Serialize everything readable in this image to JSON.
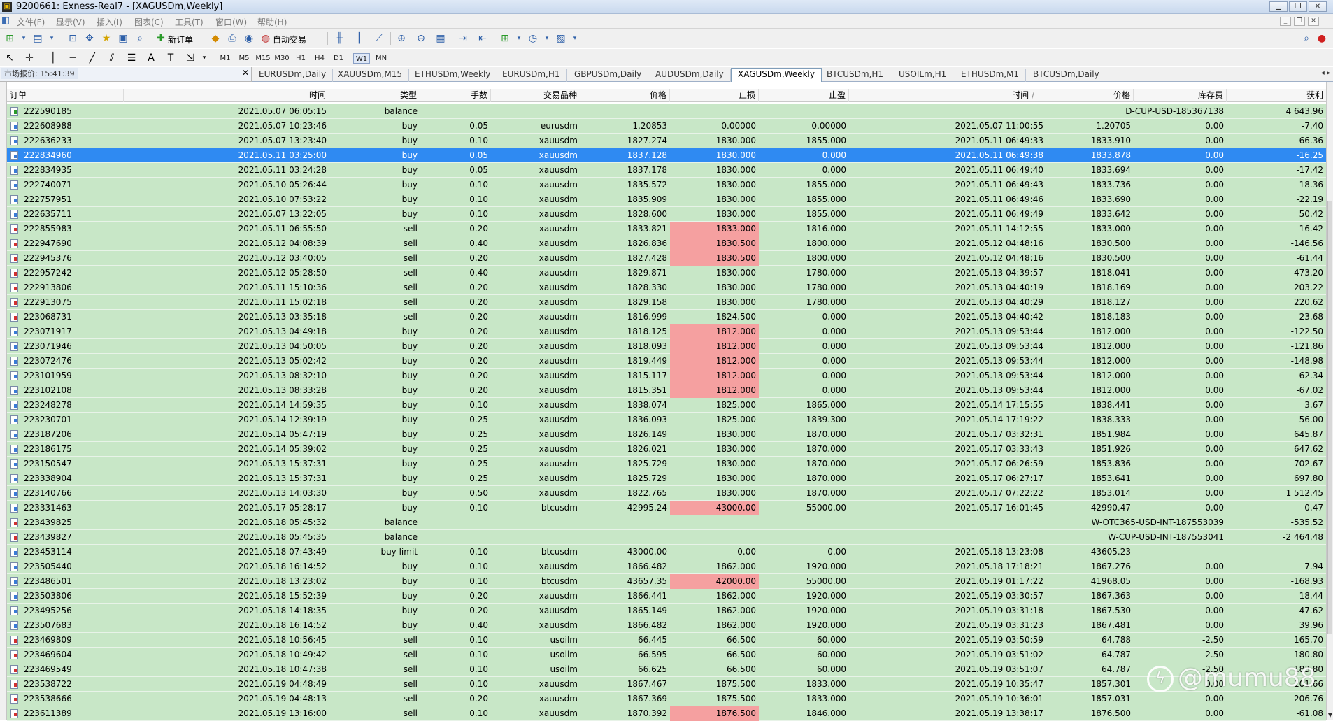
{
  "window": {
    "title": "9200661: Exness-Real7 - [XAGUSDm,Weekly]",
    "app_icon": "mt4-icon",
    "controls": [
      "minimize",
      "restore",
      "close"
    ]
  },
  "menu": [
    "文件(F)",
    "显示(V)",
    "插入(I)",
    "图表(C)",
    "工具(T)",
    "窗口(W)",
    "帮助(H)"
  ],
  "toolbar": {
    "new_order_label": "新订单",
    "auto_trading_label": "自动交易",
    "timeframes": [
      "M1",
      "M5",
      "M15",
      "M30",
      "H1",
      "H4",
      "D1",
      "W1",
      "MN"
    ],
    "active_timeframe": "W1"
  },
  "market_watch": {
    "label": "市场报价: 15:41:39"
  },
  "chart_tabs": [
    "EURUSDm,Daily",
    "XAUUSDm,M15",
    "ETHUSDm,Weekly",
    "EURUSDm,H1",
    "GBPUSDm,Daily",
    "AUDUSDm,Daily",
    "XAGUSDm,Weekly",
    "BTCUSDm,H1",
    "USOILm,H1",
    "ETHUSDm,M1",
    "BTCUSDm,Daily"
  ],
  "active_tab": "XAGUSDm,Weekly",
  "columns": [
    "订单",
    "时间",
    "类型",
    "手数",
    "交易品种",
    "价格",
    "止损",
    "止盈",
    "时间",
    "价格",
    "库存费",
    "获利"
  ],
  "sort_indicator": "/",
  "colors": {
    "row_bg": "#c8e7c7",
    "selected_bg": "#2f8af2",
    "sl_hit_bg": "#f5a0a0"
  },
  "rows": [
    {
      "order": "222590185",
      "open_time": "2021.05.07 06:05:15",
      "type": "balance",
      "lots": "",
      "symbol": "",
      "open_price": "",
      "sl": "",
      "tp": "",
      "close_time": "",
      "close_price": "D-CUP-USD-185367138",
      "swap": "",
      "profit": "4 643.96",
      "sl_hit": false,
      "icon": "balance-plus"
    },
    {
      "order": "222608988",
      "open_time": "2021.05.07 10:23:46",
      "type": "buy",
      "lots": "0.05",
      "symbol": "eurusdm",
      "open_price": "1.20853",
      "sl": "0.00000",
      "tp": "0.00000",
      "close_time": "2021.05.07 11:00:55",
      "close_price": "1.20705",
      "swap": "0.00",
      "profit": "-7.40",
      "sl_hit": false,
      "icon": "buy"
    },
    {
      "order": "222636233",
      "open_time": "2021.05.07 13:23:40",
      "type": "buy",
      "lots": "0.10",
      "symbol": "xauusdm",
      "open_price": "1827.274",
      "sl": "1830.000",
      "tp": "1855.000",
      "close_time": "2021.05.11 06:49:33",
      "close_price": "1833.910",
      "swap": "0.00",
      "profit": "66.36",
      "sl_hit": false,
      "icon": "buy"
    },
    {
      "order": "222834960",
      "open_time": "2021.05.11 03:25:00",
      "type": "buy",
      "lots": "0.05",
      "symbol": "xauusdm",
      "open_price": "1837.128",
      "sl": "1830.000",
      "tp": "0.000",
      "close_time": "2021.05.11 06:49:38",
      "close_price": "1833.878",
      "swap": "0.00",
      "profit": "-16.25",
      "sl_hit": false,
      "icon": "buy",
      "selected": true
    },
    {
      "order": "222834935",
      "open_time": "2021.05.11 03:24:28",
      "type": "buy",
      "lots": "0.05",
      "symbol": "xauusdm",
      "open_price": "1837.178",
      "sl": "1830.000",
      "tp": "0.000",
      "close_time": "2021.05.11 06:49:40",
      "close_price": "1833.694",
      "swap": "0.00",
      "profit": "-17.42",
      "sl_hit": false,
      "icon": "buy"
    },
    {
      "order": "222740071",
      "open_time": "2021.05.10 05:26:44",
      "type": "buy",
      "lots": "0.10",
      "symbol": "xauusdm",
      "open_price": "1835.572",
      "sl": "1830.000",
      "tp": "1855.000",
      "close_time": "2021.05.11 06:49:43",
      "close_price": "1833.736",
      "swap": "0.00",
      "profit": "-18.36",
      "sl_hit": false,
      "icon": "buy"
    },
    {
      "order": "222757951",
      "open_time": "2021.05.10 07:53:22",
      "type": "buy",
      "lots": "0.10",
      "symbol": "xauusdm",
      "open_price": "1835.909",
      "sl": "1830.000",
      "tp": "1855.000",
      "close_time": "2021.05.11 06:49:46",
      "close_price": "1833.690",
      "swap": "0.00",
      "profit": "-22.19",
      "sl_hit": false,
      "icon": "buy"
    },
    {
      "order": "222635711",
      "open_time": "2021.05.07 13:22:05",
      "type": "buy",
      "lots": "0.10",
      "symbol": "xauusdm",
      "open_price": "1828.600",
      "sl": "1830.000",
      "tp": "1855.000",
      "close_time": "2021.05.11 06:49:49",
      "close_price": "1833.642",
      "swap": "0.00",
      "profit": "50.42",
      "sl_hit": false,
      "icon": "buy"
    },
    {
      "order": "222855983",
      "open_time": "2021.05.11 06:55:50",
      "type": "sell",
      "lots": "0.20",
      "symbol": "xauusdm",
      "open_price": "1833.821",
      "sl": "1833.000",
      "tp": "1816.000",
      "close_time": "2021.05.11 14:12:55",
      "close_price": "1833.000",
      "swap": "0.00",
      "profit": "16.42",
      "sl_hit": true,
      "icon": "sell"
    },
    {
      "order": "222947690",
      "open_time": "2021.05.12 04:08:39",
      "type": "sell",
      "lots": "0.40",
      "symbol": "xauusdm",
      "open_price": "1826.836",
      "sl": "1830.500",
      "tp": "1800.000",
      "close_time": "2021.05.12 04:48:16",
      "close_price": "1830.500",
      "swap": "0.00",
      "profit": "-146.56",
      "sl_hit": true,
      "icon": "sell"
    },
    {
      "order": "222945376",
      "open_time": "2021.05.12 03:40:05",
      "type": "sell",
      "lots": "0.20",
      "symbol": "xauusdm",
      "open_price": "1827.428",
      "sl": "1830.500",
      "tp": "1800.000",
      "close_time": "2021.05.12 04:48:16",
      "close_price": "1830.500",
      "swap": "0.00",
      "profit": "-61.44",
      "sl_hit": true,
      "icon": "sell"
    },
    {
      "order": "222957242",
      "open_time": "2021.05.12 05:28:50",
      "type": "sell",
      "lots": "0.40",
      "symbol": "xauusdm",
      "open_price": "1829.871",
      "sl": "1830.000",
      "tp": "1780.000",
      "close_time": "2021.05.13 04:39:57",
      "close_price": "1818.041",
      "swap": "0.00",
      "profit": "473.20",
      "sl_hit": false,
      "icon": "sell"
    },
    {
      "order": "222913806",
      "open_time": "2021.05.11 15:10:36",
      "type": "sell",
      "lots": "0.20",
      "symbol": "xauusdm",
      "open_price": "1828.330",
      "sl": "1830.000",
      "tp": "1780.000",
      "close_time": "2021.05.13 04:40:19",
      "close_price": "1818.169",
      "swap": "0.00",
      "profit": "203.22",
      "sl_hit": false,
      "icon": "sell"
    },
    {
      "order": "222913075",
      "open_time": "2021.05.11 15:02:18",
      "type": "sell",
      "lots": "0.20",
      "symbol": "xauusdm",
      "open_price": "1829.158",
      "sl": "1830.000",
      "tp": "1780.000",
      "close_time": "2021.05.13 04:40:29",
      "close_price": "1818.127",
      "swap": "0.00",
      "profit": "220.62",
      "sl_hit": false,
      "icon": "sell"
    },
    {
      "order": "223068731",
      "open_time": "2021.05.13 03:35:18",
      "type": "sell",
      "lots": "0.20",
      "symbol": "xauusdm",
      "open_price": "1816.999",
      "sl": "1824.500",
      "tp": "0.000",
      "close_time": "2021.05.13 04:40:42",
      "close_price": "1818.183",
      "swap": "0.00",
      "profit": "-23.68",
      "sl_hit": false,
      "icon": "sell"
    },
    {
      "order": "223071917",
      "open_time": "2021.05.13 04:49:18",
      "type": "buy",
      "lots": "0.20",
      "symbol": "xauusdm",
      "open_price": "1818.125",
      "sl": "1812.000",
      "tp": "0.000",
      "close_time": "2021.05.13 09:53:44",
      "close_price": "1812.000",
      "swap": "0.00",
      "profit": "-122.50",
      "sl_hit": true,
      "icon": "buy"
    },
    {
      "order": "223071946",
      "open_time": "2021.05.13 04:50:05",
      "type": "buy",
      "lots": "0.20",
      "symbol": "xauusdm",
      "open_price": "1818.093",
      "sl": "1812.000",
      "tp": "0.000",
      "close_time": "2021.05.13 09:53:44",
      "close_price": "1812.000",
      "swap": "0.00",
      "profit": "-121.86",
      "sl_hit": true,
      "icon": "buy"
    },
    {
      "order": "223072476",
      "open_time": "2021.05.13 05:02:42",
      "type": "buy",
      "lots": "0.20",
      "symbol": "xauusdm",
      "open_price": "1819.449",
      "sl": "1812.000",
      "tp": "0.000",
      "close_time": "2021.05.13 09:53:44",
      "close_price": "1812.000",
      "swap": "0.00",
      "profit": "-148.98",
      "sl_hit": true,
      "icon": "buy"
    },
    {
      "order": "223101959",
      "open_time": "2021.05.13 08:32:10",
      "type": "buy",
      "lots": "0.20",
      "symbol": "xauusdm",
      "open_price": "1815.117",
      "sl": "1812.000",
      "tp": "0.000",
      "close_time": "2021.05.13 09:53:44",
      "close_price": "1812.000",
      "swap": "0.00",
      "profit": "-62.34",
      "sl_hit": true,
      "icon": "buy"
    },
    {
      "order": "223102108",
      "open_time": "2021.05.13 08:33:28",
      "type": "buy",
      "lots": "0.20",
      "symbol": "xauusdm",
      "open_price": "1815.351",
      "sl": "1812.000",
      "tp": "0.000",
      "close_time": "2021.05.13 09:53:44",
      "close_price": "1812.000",
      "swap": "0.00",
      "profit": "-67.02",
      "sl_hit": true,
      "icon": "buy"
    },
    {
      "order": "223248278",
      "open_time": "2021.05.14 14:59:35",
      "type": "buy",
      "lots": "0.10",
      "symbol": "xauusdm",
      "open_price": "1838.074",
      "sl": "1825.000",
      "tp": "1865.000",
      "close_time": "2021.05.14 17:15:55",
      "close_price": "1838.441",
      "swap": "0.00",
      "profit": "3.67",
      "sl_hit": false,
      "icon": "buy"
    },
    {
      "order": "223230701",
      "open_time": "2021.05.14 12:39:19",
      "type": "buy",
      "lots": "0.25",
      "symbol": "xauusdm",
      "open_price": "1836.093",
      "sl": "1825.000",
      "tp": "1839.300",
      "close_time": "2021.05.14 17:19:22",
      "close_price": "1838.333",
      "swap": "0.00",
      "profit": "56.00",
      "sl_hit": false,
      "icon": "buy"
    },
    {
      "order": "223187206",
      "open_time": "2021.05.14 05:47:19",
      "type": "buy",
      "lots": "0.25",
      "symbol": "xauusdm",
      "open_price": "1826.149",
      "sl": "1830.000",
      "tp": "1870.000",
      "close_time": "2021.05.17 03:32:31",
      "close_price": "1851.984",
      "swap": "0.00",
      "profit": "645.87",
      "sl_hit": false,
      "icon": "buy"
    },
    {
      "order": "223186175",
      "open_time": "2021.05.14 05:39:02",
      "type": "buy",
      "lots": "0.25",
      "symbol": "xauusdm",
      "open_price": "1826.021",
      "sl": "1830.000",
      "tp": "1870.000",
      "close_time": "2021.05.17 03:33:43",
      "close_price": "1851.926",
      "swap": "0.00",
      "profit": "647.62",
      "sl_hit": false,
      "icon": "buy"
    },
    {
      "order": "223150547",
      "open_time": "2021.05.13 15:37:31",
      "type": "buy",
      "lots": "0.25",
      "symbol": "xauusdm",
      "open_price": "1825.729",
      "sl": "1830.000",
      "tp": "1870.000",
      "close_time": "2021.05.17 06:26:59",
      "close_price": "1853.836",
      "swap": "0.00",
      "profit": "702.67",
      "sl_hit": false,
      "icon": "buy"
    },
    {
      "order": "223338904",
      "open_time": "2021.05.13 15:37:31",
      "type": "buy",
      "lots": "0.25",
      "symbol": "xauusdm",
      "open_price": "1825.729",
      "sl": "1830.000",
      "tp": "1870.000",
      "close_time": "2021.05.17 06:27:17",
      "close_price": "1853.641",
      "swap": "0.00",
      "profit": "697.80",
      "sl_hit": false,
      "icon": "buy"
    },
    {
      "order": "223140766",
      "open_time": "2021.05.13 14:03:30",
      "type": "buy",
      "lots": "0.50",
      "symbol": "xauusdm",
      "open_price": "1822.765",
      "sl": "1830.000",
      "tp": "1870.000",
      "close_time": "2021.05.17 07:22:22",
      "close_price": "1853.014",
      "swap": "0.00",
      "profit": "1 512.45",
      "sl_hit": false,
      "icon": "buy"
    },
    {
      "order": "223331463",
      "open_time": "2021.05.17 05:28:17",
      "type": "buy",
      "lots": "0.10",
      "symbol": "btcusdm",
      "open_price": "42995.24",
      "sl": "43000.00",
      "tp": "55000.00",
      "close_time": "2021.05.17 16:01:45",
      "close_price": "42990.47",
      "swap": "0.00",
      "profit": "-0.47",
      "sl_hit": true,
      "icon": "buy"
    },
    {
      "order": "223439825",
      "open_time": "2021.05.18 05:45:32",
      "type": "balance",
      "lots": "",
      "symbol": "",
      "open_price": "",
      "sl": "",
      "tp": "",
      "close_time": "",
      "close_price": "W-OTC365-USD-INT-187553039",
      "swap": "",
      "profit": "-535.52",
      "sl_hit": false,
      "icon": "balance-minus"
    },
    {
      "order": "223439827",
      "open_time": "2021.05.18 05:45:35",
      "type": "balance",
      "lots": "",
      "symbol": "",
      "open_price": "",
      "sl": "",
      "tp": "",
      "close_time": "",
      "close_price": "W-CUP-USD-INT-187553041",
      "swap": "",
      "profit": "-2 464.48",
      "sl_hit": false,
      "icon": "balance-minus"
    },
    {
      "order": "223453114",
      "open_time": "2021.05.18 07:43:49",
      "type": "buy limit",
      "lots": "0.10",
      "symbol": "btcusdm",
      "open_price": "43000.00",
      "sl": "0.00",
      "tp": "0.00",
      "close_time": "2021.05.18 13:23:08",
      "close_price": "43605.23",
      "swap": "",
      "profit": "",
      "sl_hit": false,
      "icon": "buy"
    },
    {
      "order": "223505440",
      "open_time": "2021.05.18 16:14:52",
      "type": "buy",
      "lots": "0.10",
      "symbol": "xauusdm",
      "open_price": "1866.482",
      "sl": "1862.000",
      "tp": "1920.000",
      "close_time": "2021.05.18 17:18:21",
      "close_price": "1867.276",
      "swap": "0.00",
      "profit": "7.94",
      "sl_hit": false,
      "icon": "buy"
    },
    {
      "order": "223486501",
      "open_time": "2021.05.18 13:23:02",
      "type": "buy",
      "lots": "0.10",
      "symbol": "btcusdm",
      "open_price": "43657.35",
      "sl": "42000.00",
      "tp": "55000.00",
      "close_time": "2021.05.19 01:17:22",
      "close_price": "41968.05",
      "swap": "0.00",
      "profit": "-168.93",
      "sl_hit": true,
      "icon": "buy"
    },
    {
      "order": "223503806",
      "open_time": "2021.05.18 15:52:39",
      "type": "buy",
      "lots": "0.20",
      "symbol": "xauusdm",
      "open_price": "1866.441",
      "sl": "1862.000",
      "tp": "1920.000",
      "close_time": "2021.05.19 03:30:57",
      "close_price": "1867.363",
      "swap": "0.00",
      "profit": "18.44",
      "sl_hit": false,
      "icon": "buy"
    },
    {
      "order": "223495256",
      "open_time": "2021.05.18 14:18:35",
      "type": "buy",
      "lots": "0.20",
      "symbol": "xauusdm",
      "open_price": "1865.149",
      "sl": "1862.000",
      "tp": "1920.000",
      "close_time": "2021.05.19 03:31:18",
      "close_price": "1867.530",
      "swap": "0.00",
      "profit": "47.62",
      "sl_hit": false,
      "icon": "buy"
    },
    {
      "order": "223507683",
      "open_time": "2021.05.18 16:14:52",
      "type": "buy",
      "lots": "0.40",
      "symbol": "xauusdm",
      "open_price": "1866.482",
      "sl": "1862.000",
      "tp": "1920.000",
      "close_time": "2021.05.19 03:31:23",
      "close_price": "1867.481",
      "swap": "0.00",
      "profit": "39.96",
      "sl_hit": false,
      "icon": "buy"
    },
    {
      "order": "223469809",
      "open_time": "2021.05.18 10:56:45",
      "type": "sell",
      "lots": "0.10",
      "symbol": "usoilm",
      "open_price": "66.445",
      "sl": "66.500",
      "tp": "60.000",
      "close_time": "2021.05.19 03:50:59",
      "close_price": "64.788",
      "swap": "-2.50",
      "profit": "165.70",
      "sl_hit": false,
      "icon": "sell"
    },
    {
      "order": "223469604",
      "open_time": "2021.05.18 10:49:42",
      "type": "sell",
      "lots": "0.10",
      "symbol": "usoilm",
      "open_price": "66.595",
      "sl": "66.500",
      "tp": "60.000",
      "close_time": "2021.05.19 03:51:02",
      "close_price": "64.787",
      "swap": "-2.50",
      "profit": "180.80",
      "sl_hit": false,
      "icon": "sell"
    },
    {
      "order": "223469549",
      "open_time": "2021.05.18 10:47:38",
      "type": "sell",
      "lots": "0.10",
      "symbol": "usoilm",
      "open_price": "66.625",
      "sl": "66.500",
      "tp": "60.000",
      "close_time": "2021.05.19 03:51:07",
      "close_price": "64.787",
      "swap": "-2.50",
      "profit": "183.80",
      "sl_hit": false,
      "icon": "sell"
    },
    {
      "order": "223538722",
      "open_time": "2021.05.19 04:48:49",
      "type": "sell",
      "lots": "0.10",
      "symbol": "xauusdm",
      "open_price": "1867.467",
      "sl": "1875.500",
      "tp": "1833.000",
      "close_time": "2021.05.19 10:35:47",
      "close_price": "1857.301",
      "swap": "0.00",
      "profit": "101.66",
      "sl_hit": false,
      "icon": "sell"
    },
    {
      "order": "223538666",
      "open_time": "2021.05.19 04:48:13",
      "type": "sell",
      "lots": "0.20",
      "symbol": "xauusdm",
      "open_price": "1867.369",
      "sl": "1875.500",
      "tp": "1833.000",
      "close_time": "2021.05.19 10:36:01",
      "close_price": "1857.031",
      "swap": "0.00",
      "profit": "206.76",
      "sl_hit": false,
      "icon": "sell"
    },
    {
      "order": "223611389",
      "open_time": "2021.05.19 13:16:00",
      "type": "sell",
      "lots": "0.10",
      "symbol": "xauusdm",
      "open_price": "1870.392",
      "sl": "1876.500",
      "tp": "1846.000",
      "close_time": "2021.05.19 13:38:17",
      "close_price": "1876.500",
      "swap": "0.00",
      "profit": "-61.08",
      "sl_hit": true,
      "icon": "sell"
    }
  ],
  "watermark": "@mumu88"
}
